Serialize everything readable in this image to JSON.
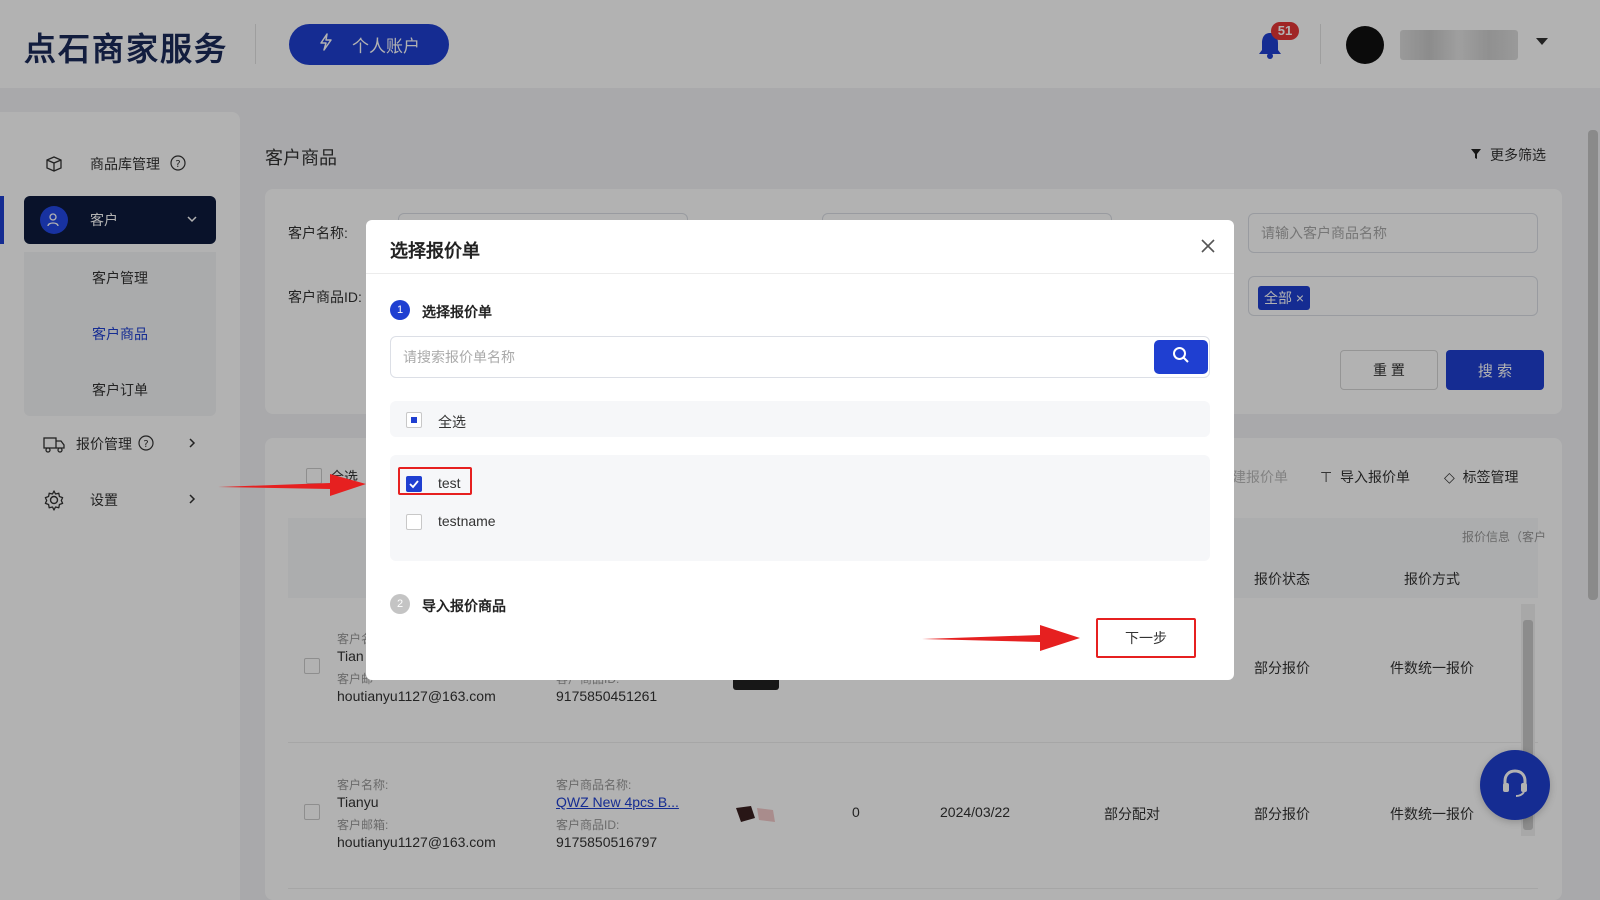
{
  "header": {
    "logo": "点石商家服务",
    "account_button": "个人账户",
    "notification_count": "51"
  },
  "sidebar": {
    "items": [
      {
        "label": "商品库管理",
        "icon": "box-icon"
      },
      {
        "label": "客户",
        "icon": "customer-icon"
      },
      {
        "label": "报价管理",
        "icon": "truck-icon"
      },
      {
        "label": "设置",
        "icon": "gear-icon"
      }
    ],
    "sub_items": [
      "客户管理",
      "客户商品",
      "客户订单"
    ]
  },
  "page": {
    "title": "客户商品",
    "more_filter": "更多筛选"
  },
  "filters": {
    "customer_name_label": "客户名称:",
    "customer_product_id_label": "客户商品ID:",
    "product_name_placeholder": "请输入客户商品名称",
    "tag_all": "全部",
    "reset": "重 置",
    "search": "搜 索"
  },
  "table": {
    "select_all": "全选",
    "toolbar": {
      "create_quote": "建报价单",
      "import_quote": "导入报价单",
      "tag_manage": "标签管理"
    },
    "group_header": "报价信息（客户",
    "headers": {
      "quote_status": "报价状态",
      "quote_method": "报价方式"
    },
    "rows": [
      {
        "customer_name_label": "客户名",
        "customer_name": "Tian",
        "customer_email_label": "客户邮",
        "customer_email": "houtianyu1127@163.com",
        "product_id_label": "客户商品ID:",
        "product_id": "9175850451261",
        "quote_status": "部分报价",
        "quote_method": "件数统一报价"
      },
      {
        "customer_name_label": "客户名称:",
        "customer_name": "Tianyu",
        "customer_email_label": "客户邮箱:",
        "customer_email": "houtianyu1127@163.com",
        "product_name_label": "客户商品名称:",
        "product_name": "QWZ New 4pcs B...",
        "product_id_label": "客户商品ID:",
        "product_id": "9175850516797",
        "quantity": "0",
        "date": "2024/03/22",
        "match_status": "部分配对",
        "quote_status": "部分报价",
        "quote_method": "件数统一报价"
      }
    ]
  },
  "dialog": {
    "title": "选择报价单",
    "step1_num": "1",
    "step1_label": "选择报价单",
    "search_placeholder": "请搜索报价单名称",
    "select_all": "全选",
    "options": [
      {
        "label": "test",
        "checked": true
      },
      {
        "label": "testname",
        "checked": false
      }
    ],
    "step2_num": "2",
    "step2_label": "导入报价商品",
    "next_button": "下一步"
  },
  "colors": {
    "primary": "#1f3fd1",
    "sidebar_active": "#0e1a3d",
    "annotation_red": "#e62020"
  }
}
